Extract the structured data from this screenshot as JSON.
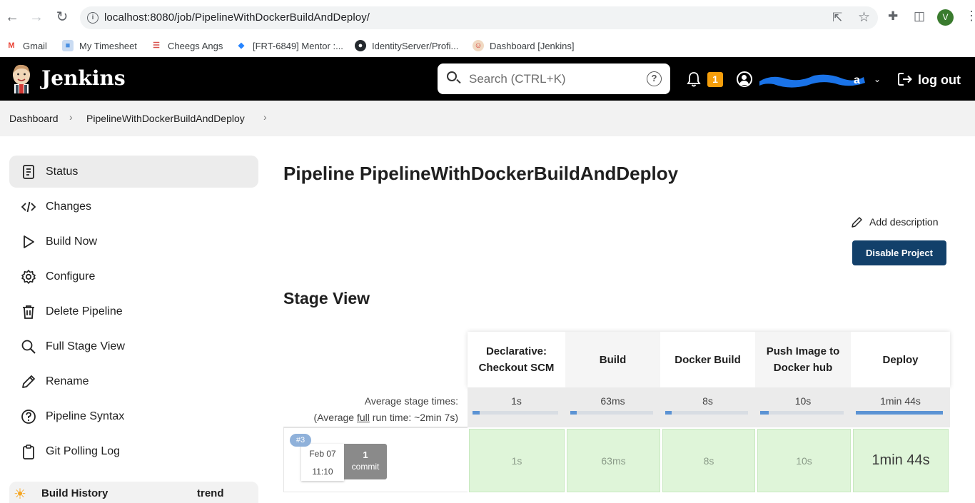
{
  "browser": {
    "url": "localhost:8080/job/PipelineWithDockerBuildAndDeploy/",
    "profile_initial": "V",
    "bookmarks": [
      {
        "label": "Gmail",
        "icon": "gmail-icon",
        "color": "#ea4335"
      },
      {
        "label": "My Timesheet",
        "icon": "timesheet-icon",
        "color": "#4a90e2"
      },
      {
        "label": "Cheegs Angs",
        "icon": "books-icon",
        "color": "#d9534f"
      },
      {
        "label": "[FRT-6849] Mentor :...",
        "icon": "jira-icon",
        "color": "#2684ff"
      },
      {
        "label": "IdentityServer/Profi...",
        "icon": "github-icon",
        "color": "#24292e"
      },
      {
        "label": "Dashboard [Jenkins]",
        "icon": "jenkins-icon",
        "color": "#d33833"
      }
    ]
  },
  "header": {
    "title": "Jenkins",
    "search_placeholder": "Search (CTRL+K)",
    "help_glyph": "?",
    "notification_count": "1",
    "user_name": "a",
    "logout_label": "log out"
  },
  "breadcrumb": [
    "Dashboard",
    "PipelineWithDockerBuildAndDeploy"
  ],
  "sidebar": {
    "items": [
      {
        "label": "Status",
        "icon": "status-icon"
      },
      {
        "label": "Changes",
        "icon": "code-icon"
      },
      {
        "label": "Build Now",
        "icon": "play-icon"
      },
      {
        "label": "Configure",
        "icon": "gear-icon"
      },
      {
        "label": "Delete Pipeline",
        "icon": "trash-icon"
      },
      {
        "label": "Full Stage View",
        "icon": "search-icon"
      },
      {
        "label": "Rename",
        "icon": "pencil-icon"
      },
      {
        "label": "Pipeline Syntax",
        "icon": "help-circle-icon"
      },
      {
        "label": "Git Polling Log",
        "icon": "clipboard-icon"
      }
    ],
    "build_history_label": "Build History",
    "build_history_trend": "trend"
  },
  "main": {
    "title": "Pipeline PipelineWithDockerBuildAndDeploy",
    "add_description": "Add description",
    "disable_button": "Disable Project",
    "stage_view_title": "Stage View"
  },
  "stage_view": {
    "avg_label_line1": "Average stage times:",
    "avg_label_pre": "(Average ",
    "avg_label_link": "full",
    "avg_label_post": " run time: ~2min 7s)",
    "stages": [
      {
        "name": "Declarative: Checkout SCM",
        "avg": "1s",
        "fraction": 0.01,
        "run_time": "1s"
      },
      {
        "name": "Build",
        "avg": "63ms",
        "fraction": 0.01,
        "run_time": "63ms"
      },
      {
        "name": "Docker Build",
        "avg": "8s",
        "fraction": 0.08,
        "run_time": "8s"
      },
      {
        "name": "Push Image to Docker hub",
        "avg": "10s",
        "fraction": 0.1,
        "run_time": "10s"
      },
      {
        "name": "Deploy",
        "avg": "1min 44s",
        "fraction": 1.0,
        "run_time": "1min 44s"
      }
    ],
    "run": {
      "badge": "#3",
      "date": "Feb 07",
      "time": "11:10",
      "commit_count": "1",
      "commit_label": "commit"
    }
  }
}
